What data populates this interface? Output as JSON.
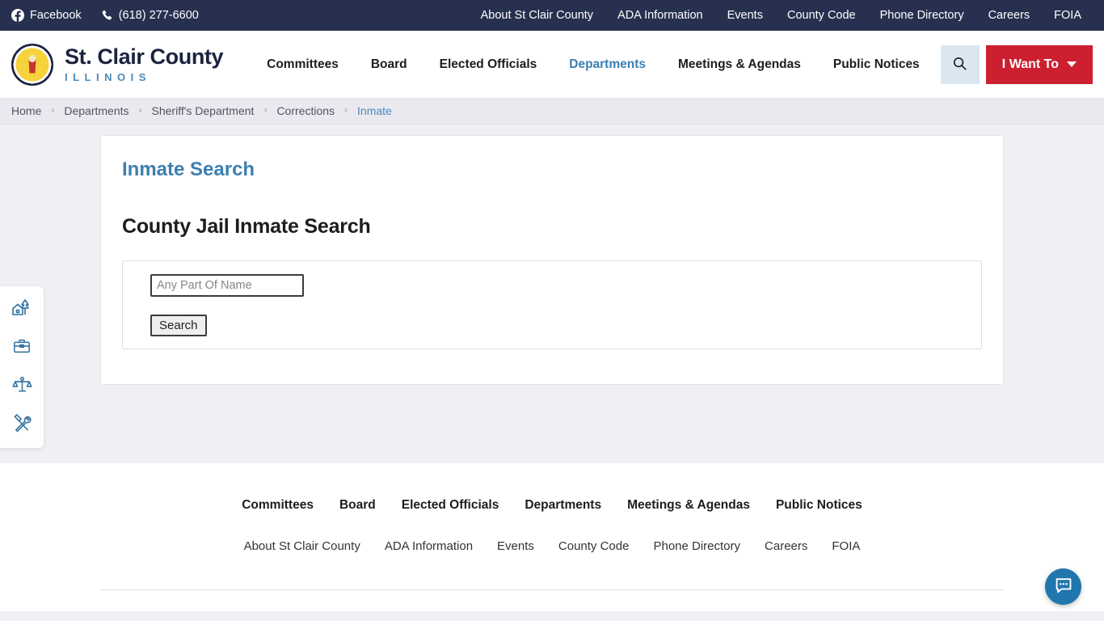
{
  "topbar": {
    "facebook_label": "Facebook",
    "phone_label": "(618) 277-6600",
    "links": [
      {
        "label": "About St Clair County"
      },
      {
        "label": "ADA Information"
      },
      {
        "label": "Events"
      },
      {
        "label": "County Code"
      },
      {
        "label": "Phone Directory"
      },
      {
        "label": "Careers"
      },
      {
        "label": "FOIA"
      }
    ],
    "background": "#27304f"
  },
  "header": {
    "brand_name": "St. Clair County",
    "brand_sub": "ILLINOIS",
    "nav": [
      {
        "label": "Committees",
        "active": false
      },
      {
        "label": "Board",
        "active": false
      },
      {
        "label": "Elected Officials",
        "active": false
      },
      {
        "label": "Departments",
        "active": true
      },
      {
        "label": "Meetings & Agendas",
        "active": false
      },
      {
        "label": "Public Notices",
        "active": false
      }
    ],
    "search_icon": "search-icon",
    "i_want_to_label": "I Want To",
    "accent_red": "#cc2030",
    "accent_blue": "#3c7fb1"
  },
  "breadcrumb": {
    "separator": "›",
    "items": [
      {
        "label": "Home",
        "current": false
      },
      {
        "label": "Departments",
        "current": false
      },
      {
        "label": "Sheriff's Department",
        "current": false
      },
      {
        "label": "Corrections",
        "current": false
      },
      {
        "label": "Inmate",
        "current": true
      }
    ]
  },
  "rail": {
    "items": [
      {
        "icon": "house-trees-icon",
        "name": "property"
      },
      {
        "icon": "briefcase-icon",
        "name": "business"
      },
      {
        "icon": "scales-of-justice-icon",
        "name": "justice"
      },
      {
        "icon": "tools-icon",
        "name": "services"
      }
    ]
  },
  "main": {
    "card_title": "Inmate Search",
    "page_heading": "County Jail Inmate Search",
    "form": {
      "name_placeholder": "Any Part Of Name",
      "name_value": "",
      "search_button_label": "Search"
    }
  },
  "footer": {
    "primary_links": [
      {
        "label": "Committees"
      },
      {
        "label": "Board"
      },
      {
        "label": "Elected Officials"
      },
      {
        "label": "Departments"
      },
      {
        "label": "Meetings & Agendas"
      },
      {
        "label": "Public Notices"
      }
    ],
    "secondary_links": [
      {
        "label": "About St Clair County"
      },
      {
        "label": "ADA Information"
      },
      {
        "label": "Events"
      },
      {
        "label": "County Code"
      },
      {
        "label": "Phone Directory"
      },
      {
        "label": "Careers"
      },
      {
        "label": "FOIA"
      }
    ]
  },
  "chat": {
    "icon": "chat-bubble-icon",
    "color": "#2176ae"
  }
}
